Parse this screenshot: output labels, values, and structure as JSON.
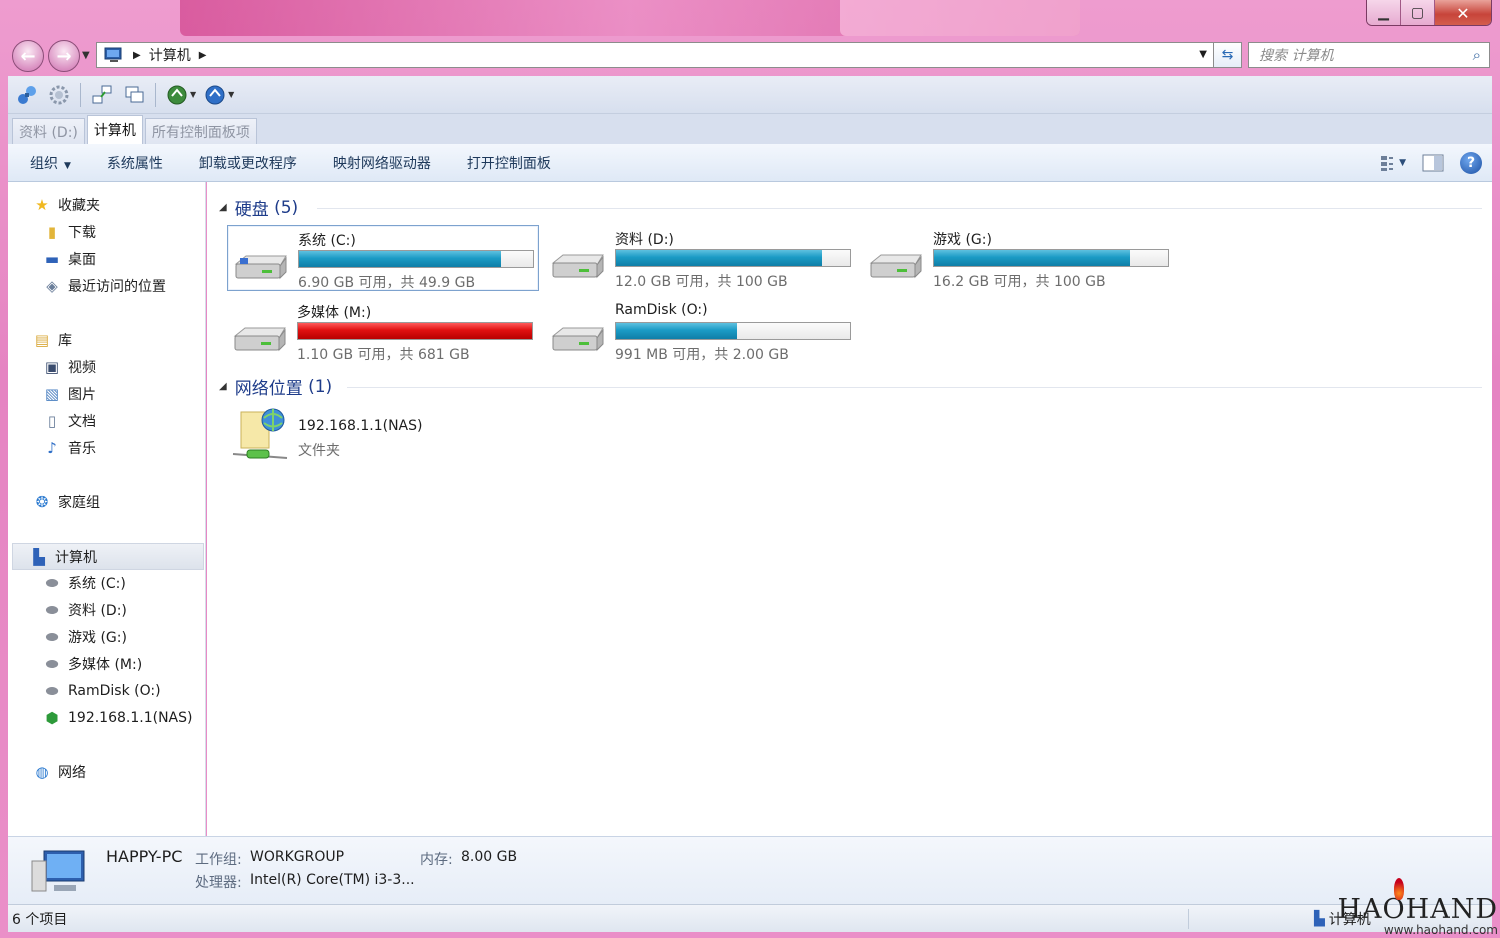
{
  "window": {
    "caption": {
      "minimize": "▁",
      "maximize": "▢",
      "close": "✕"
    }
  },
  "nav": {
    "breadcrumb": [
      "计算机"
    ],
    "search_placeholder": "搜索 计算机"
  },
  "tabs": [
    {
      "label": "资料 (D:)",
      "active": false
    },
    {
      "label": "计算机",
      "active": true
    },
    {
      "label": "所有控制面板项",
      "active": false
    }
  ],
  "commands": {
    "organize": "组织",
    "system_properties": "系统属性",
    "uninstall": "卸载或更改程序",
    "map_drive": "映射网络驱动器",
    "open_control_panel": "打开控制面板"
  },
  "sidebar": {
    "favorites": "收藏夹",
    "downloads": "下载",
    "desktop": "桌面",
    "recent": "最近访问的位置",
    "libraries": "库",
    "videos": "视频",
    "pictures": "图片",
    "documents": "文档",
    "music": "音乐",
    "homegroup": "家庭组",
    "computer": "计算机",
    "drives": [
      "系统 (C:)",
      "资料 (D:)",
      "游戏 (G:)",
      "多媒体 (M:)",
      "RamDisk (O:)",
      "192.168.1.1(NAS)"
    ],
    "network": "网络"
  },
  "groups": {
    "hard_disks": {
      "title": "硬盘",
      "count": "(5)"
    },
    "network_locations": {
      "title": "网络位置",
      "count": "(1)"
    }
  },
  "drives": [
    {
      "name": "系统 (C:)",
      "info": "6.90 GB 可用，共 49.9 GB",
      "used_fraction": 0.862,
      "color": "#1b9bc5"
    },
    {
      "name": "资料 (D:)",
      "info": "12.0 GB 可用，共 100 GB",
      "used_fraction": 0.88,
      "color": "#1b9bc5"
    },
    {
      "name": "游戏 (G:)",
      "info": "16.2 GB 可用，共 100 GB",
      "used_fraction": 0.838,
      "color": "#1b9bc5"
    },
    {
      "name": "多媒体 (M:)",
      "info": "1.10 GB 可用，共 681 GB",
      "used_fraction": 0.998,
      "color": "#e01010"
    },
    {
      "name": "RamDisk (O:)",
      "info": "991 MB 可用，共 2.00 GB",
      "used_fraction": 0.516,
      "color": "#1b9bc5"
    }
  ],
  "network_location": {
    "name": "192.168.1.1(NAS)",
    "type": "文件夹"
  },
  "details": {
    "pc_name": "HAPPY-PC",
    "workgroup_label": "工作组:",
    "workgroup_value": "WORKGROUP",
    "memory_label": "内存:",
    "memory_value": "8.00 GB",
    "processor_label": "处理器:",
    "processor_value": "Intel(R) Core(TM) i3-3..."
  },
  "status": {
    "items_count": "6 个项目",
    "location": "计算机"
  },
  "watermark": {
    "brand": "HAOHAND",
    "url": "www.haohand.com"
  }
}
